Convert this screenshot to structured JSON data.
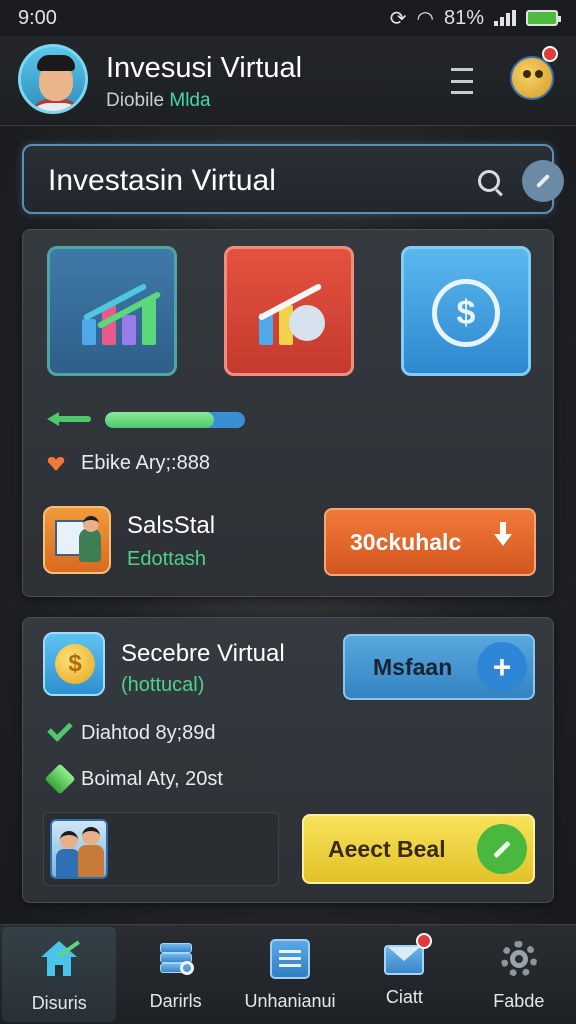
{
  "status_bar": {
    "time": "9:00",
    "battery_percent": "81%"
  },
  "header": {
    "title": "Invesusi Virtual",
    "subtitle_main": "Diobile",
    "subtitle_accent": "Mlda"
  },
  "search": {
    "value": "Investasin Virtual"
  },
  "card1": {
    "progress": 0.78,
    "stat": "Ebike Ary;:888",
    "item_title": "SalsStal",
    "item_subtitle": "Edottash",
    "button_label": "30ckuhalc"
  },
  "card2": {
    "item_title": "Secebre Virtual",
    "item_subtitle": "(hottucal)",
    "top_button_label": "Msfaan",
    "check_row": "Diahtod 8y;89d",
    "gem_row": "Boimal Aty, 20st",
    "action_button_label": "Aeect Beal"
  },
  "nav": [
    {
      "label": "Disuris",
      "icon": "home-chart-icon",
      "active": true
    },
    {
      "label": "Darirls",
      "icon": "stack-search-icon",
      "active": false
    },
    {
      "label": "Unhanianui",
      "icon": "document-icon",
      "active": false
    },
    {
      "label": "Ciatt",
      "icon": "mail-icon",
      "active": false
    },
    {
      "label": "Fabde",
      "icon": "gear-icon",
      "active": false
    }
  ],
  "colors": {
    "accent_green": "#4ec86b",
    "accent_blue": "#3a8fd4",
    "orange": "#e0622a",
    "yellow": "#f1d43c"
  }
}
